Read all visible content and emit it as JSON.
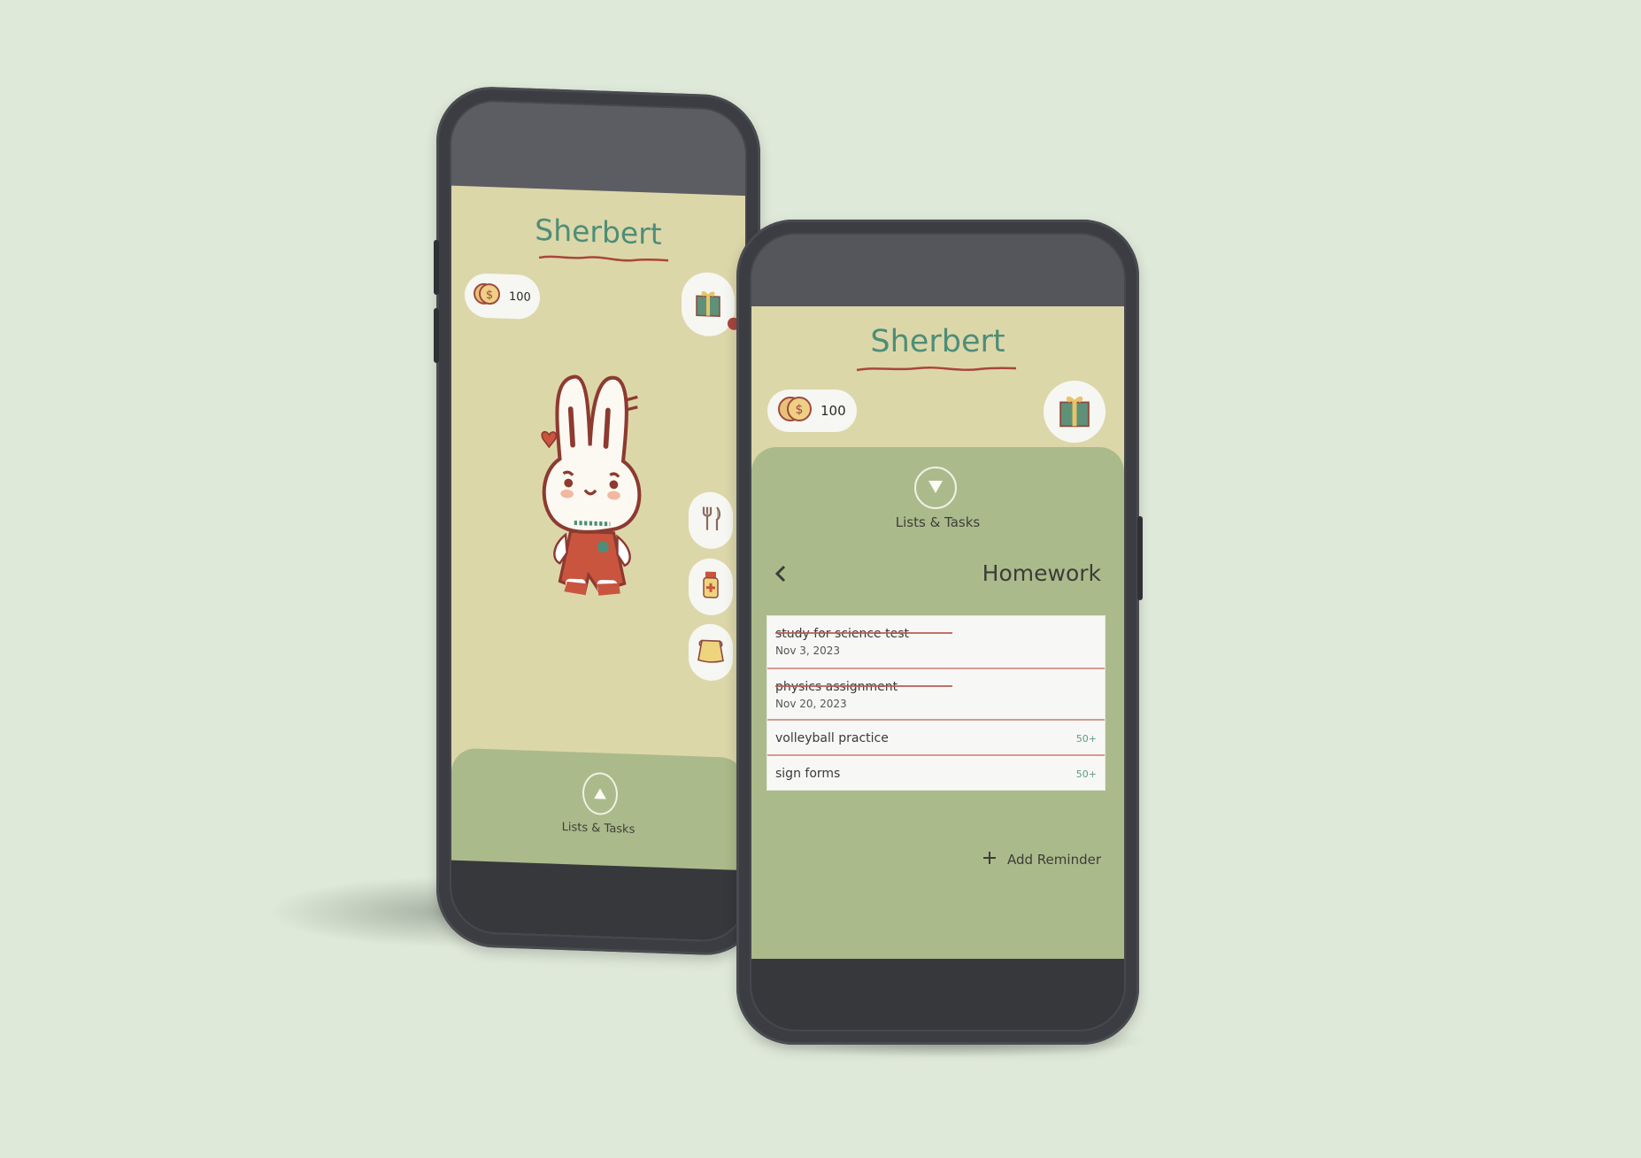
{
  "app": {
    "name": "Sherbert",
    "colors": {
      "background": "#dfe9d9",
      "screen": "#dcd7a9",
      "title": "#4e8d78",
      "underline": "#a8463d",
      "drawer": "#abba8b",
      "card": "#f7f8f5",
      "divider": "#d79a92",
      "points": "#5d9a86"
    }
  },
  "home_screen": {
    "title": "Sherbert",
    "coins": {
      "icon": "coin-icon",
      "value": "100"
    },
    "gift_button": {
      "icon": "gift-icon"
    },
    "pet": {
      "name": "bunny-character",
      "description": "white bunny in red dress with heart bow"
    },
    "care_buttons": [
      {
        "icon": "fork-knife-icon",
        "name": "feed"
      },
      {
        "icon": "medicine-bottle-icon",
        "name": "medicine"
      },
      {
        "icon": "bag-icon",
        "name": "bag"
      }
    ],
    "drawer": {
      "toggle_icon": "triangle-up-icon",
      "label": "Lists & Tasks"
    }
  },
  "list_screen": {
    "title": "Sherbert",
    "coins": {
      "icon": "coin-icon",
      "value": "100"
    },
    "gift_button": {
      "icon": "gift-icon"
    },
    "drawer": {
      "toggle_icon": "triangle-down-icon",
      "label": "Lists & Tasks"
    },
    "back_icon": "chevron-left-icon",
    "list_title": "Homework",
    "tasks": [
      {
        "title": "study for science test",
        "date": "Nov 3, 2023",
        "done": true
      },
      {
        "title": "physics assignment",
        "date": "Nov 20, 2023",
        "done": true
      },
      {
        "title": "volleyball practice",
        "points": "50+",
        "done": false
      },
      {
        "title": "sign forms",
        "points": "50+",
        "done": false
      }
    ],
    "add_button": {
      "icon": "plus-icon",
      "label": "Add Reminder"
    }
  }
}
